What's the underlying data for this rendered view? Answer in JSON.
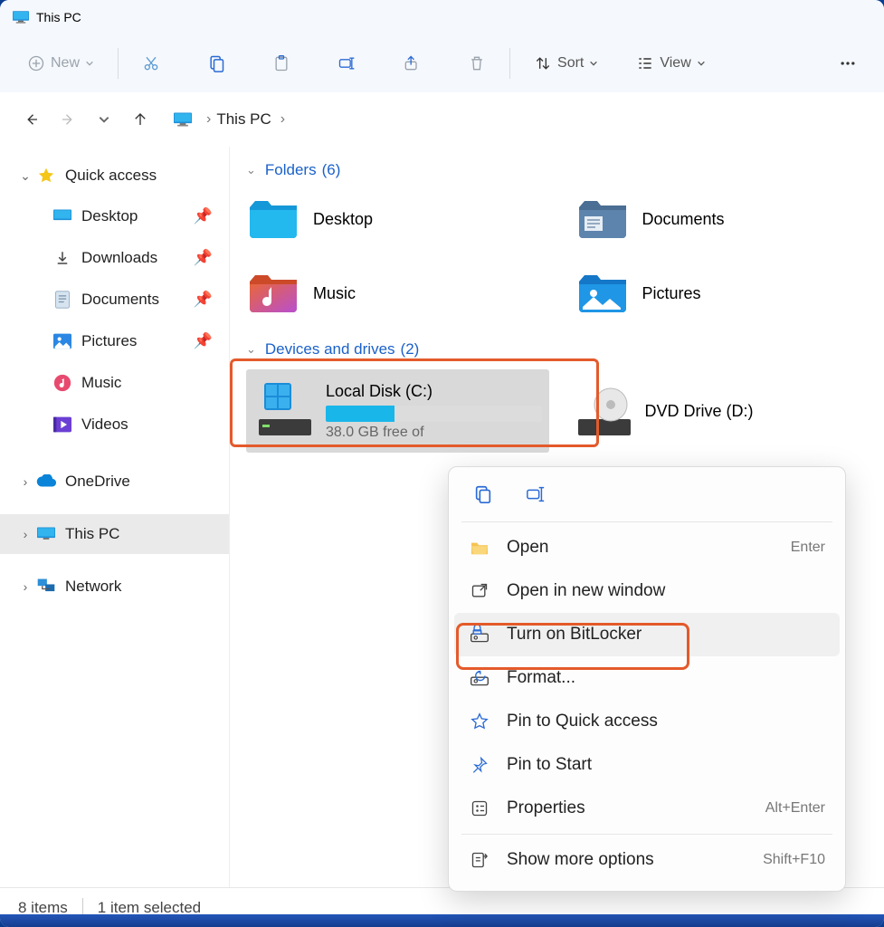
{
  "title": "This PC",
  "toolbar": {
    "new": "New",
    "sort": "Sort",
    "view": "View"
  },
  "breadcrumb": {
    "root": "This PC"
  },
  "sidebar": {
    "quick_access": "Quick access",
    "desktop": "Desktop",
    "downloads": "Downloads",
    "documents": "Documents",
    "pictures": "Pictures",
    "music": "Music",
    "videos": "Videos",
    "onedrive": "OneDrive",
    "this_pc": "This PC",
    "network": "Network"
  },
  "groups": {
    "folders_label": "Folders",
    "folders_count": "(6)",
    "drives_label": "Devices and drives",
    "drives_count": "(2)"
  },
  "folders": {
    "desktop": "Desktop",
    "documents": "Documents",
    "music": "Music",
    "pictures": "Pictures"
  },
  "drives": {
    "c": {
      "name": "Local Disk (C:)",
      "free": "38.0 GB free of",
      "fill_pct": 32
    },
    "d": {
      "name": "DVD Drive (D:)"
    }
  },
  "context_menu": {
    "open": "Open",
    "open_shortcut": "Enter",
    "open_new": "Open in new window",
    "bitlocker": "Turn on BitLocker",
    "format": "Format...",
    "pin_qa": "Pin to Quick access",
    "pin_start": "Pin to Start",
    "properties": "Properties",
    "properties_shortcut": "Alt+Enter",
    "more": "Show more options",
    "more_shortcut": "Shift+F10"
  },
  "status": {
    "items": "8 items",
    "selected": "1 item selected"
  }
}
